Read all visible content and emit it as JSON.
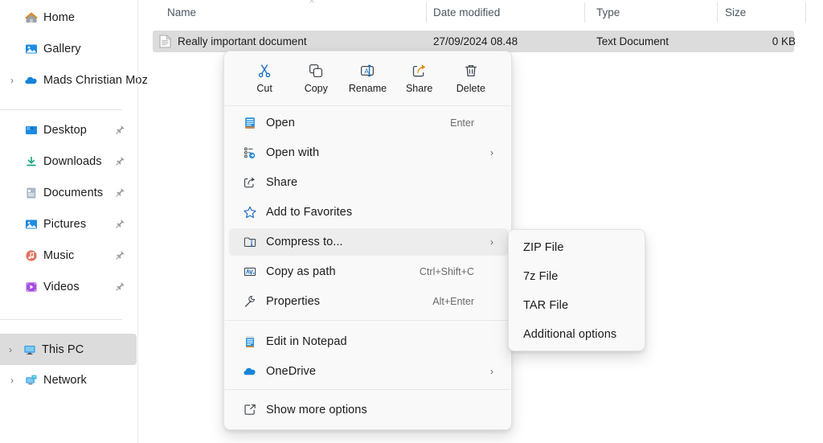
{
  "sidebar": {
    "items": [
      {
        "label": "Home",
        "icon": "home-icon",
        "chevron": false,
        "pin": false,
        "selected": false
      },
      {
        "label": "Gallery",
        "icon": "gallery-icon",
        "chevron": false,
        "pin": false,
        "selected": false
      },
      {
        "label": "Mads Christian Moz",
        "icon": "onedrive-icon",
        "chevron": true,
        "pin": false,
        "selected": false
      }
    ],
    "pinned": [
      {
        "label": "Desktop",
        "icon": "desktop-icon",
        "pin": true,
        "selected": false
      },
      {
        "label": "Downloads",
        "icon": "downloads-icon",
        "pin": true,
        "selected": false
      },
      {
        "label": "Documents",
        "icon": "documents-icon",
        "pin": true,
        "selected": false
      },
      {
        "label": "Pictures",
        "icon": "pictures-icon",
        "pin": true,
        "selected": false
      },
      {
        "label": "Music",
        "icon": "music-icon",
        "pin": true,
        "selected": false
      },
      {
        "label": "Videos",
        "icon": "videos-icon",
        "pin": true,
        "selected": false
      }
    ],
    "devices": [
      {
        "label": "This PC",
        "icon": "thispc-icon",
        "chevron": true,
        "selected": true
      },
      {
        "label": "Network",
        "icon": "network-icon",
        "chevron": true,
        "selected": false
      }
    ]
  },
  "filelist": {
    "columns": [
      {
        "label": "Name"
      },
      {
        "label": "Date modified"
      },
      {
        "label": "Type"
      },
      {
        "label": "Size"
      }
    ],
    "sort_indicator": "chevron-up-icon",
    "rows": [
      {
        "name": "Really important document",
        "date_modified": "27/09/2024 08.48",
        "type": "Text Document",
        "size": "0 KB",
        "icon": "text-document-icon",
        "selected": true
      }
    ]
  },
  "context_menu": {
    "commands": [
      {
        "label": "Cut",
        "icon": "scissors-icon"
      },
      {
        "label": "Copy",
        "icon": "copy-icon"
      },
      {
        "label": "Rename",
        "icon": "rename-icon"
      },
      {
        "label": "Share",
        "icon": "share-icon"
      },
      {
        "label": "Delete",
        "icon": "trash-icon"
      }
    ],
    "items": [
      {
        "label": "Open",
        "icon": "open-file-icon",
        "accel": "Enter",
        "arrow": false,
        "hover": false
      },
      {
        "label": "Open with",
        "icon": "open-with-icon",
        "accel": "",
        "arrow": true,
        "hover": false
      },
      {
        "label": "Share",
        "icon": "share-icon",
        "accel": "",
        "arrow": false,
        "hover": false
      },
      {
        "label": "Add to Favorites",
        "icon": "star-icon",
        "accel": "",
        "arrow": false,
        "hover": false
      },
      {
        "label": "Compress to...",
        "icon": "compress-icon",
        "accel": "",
        "arrow": true,
        "hover": true
      },
      {
        "label": "Copy as path",
        "icon": "copy-as-path-icon",
        "accel": "Ctrl+Shift+C",
        "arrow": false,
        "hover": false
      },
      {
        "label": "Properties",
        "icon": "wrench-icon",
        "accel": "Alt+Enter",
        "arrow": false,
        "hover": false
      },
      {
        "label": "Edit in Notepad",
        "icon": "notepad-icon",
        "accel": "",
        "arrow": false,
        "hover": false
      },
      {
        "label": "OneDrive",
        "icon": "onedrive-icon",
        "accel": "",
        "arrow": true,
        "hover": false
      },
      {
        "label": "Show more options",
        "icon": "more-options-icon",
        "accel": "",
        "arrow": false,
        "hover": false
      }
    ]
  },
  "submenu": {
    "items": [
      {
        "label": "ZIP File"
      },
      {
        "label": "7z File"
      },
      {
        "label": "TAR File"
      },
      {
        "label": "Additional options"
      }
    ]
  },
  "colors": {
    "accent_blue": "#0f6cbd",
    "selection_gray": "#dcdcdc",
    "hover_gray": "#ededed",
    "menu_bg": "#f9f9f9",
    "text": "#1b1b1b",
    "header_text": "#4c5560"
  }
}
